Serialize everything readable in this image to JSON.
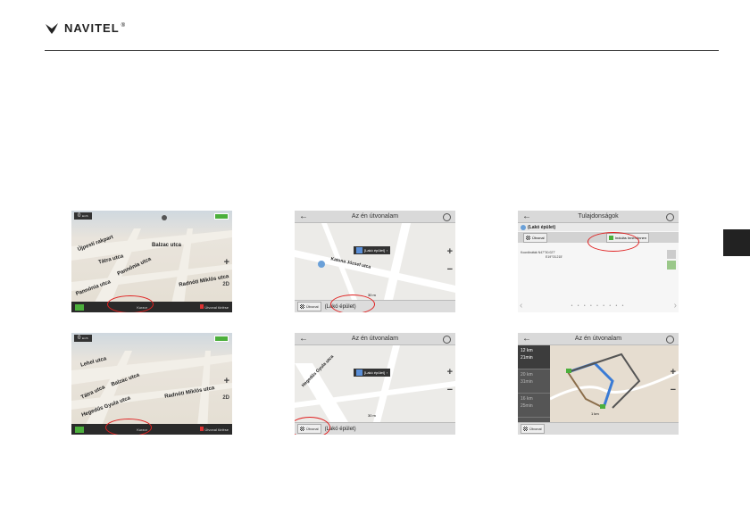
{
  "header": {
    "brand": "NAVITEL",
    "registered": "®"
  },
  "screens": {
    "map1": {
      "speed": "0",
      "speed_unit": "km/h",
      "streets": [
        "Újpesti rakpart",
        "Balzac utca",
        "Tátra utca",
        "Pannónia utca",
        "Radnóti Miklós utca",
        "Katona József utca",
        "Pannónia utca",
        "Pozsonyi út",
        "Hegedűs Gyula utca"
      ],
      "zoom_plus": "+",
      "zoom_minus": "−",
      "view_label": "2D",
      "bottom_center": "Kurzor",
      "bottom_right": "Útvonal törlése"
    },
    "route1": {
      "title": "Az én útvonalam",
      "popup_label": "[Lakó épület]",
      "street": "Katona József utca",
      "scale": "30 m",
      "route_button": "Útvonal",
      "bottom_label": "(Lakó épület)"
    },
    "props": {
      "title": "Tulajdonságok",
      "place": "(Lakó épület)",
      "toolbar_left": "Útvonal",
      "toolbar_right": "Indulás Innen/Innen",
      "coord_label": "Koordináták",
      "coord_lat": "N47°30.027'",
      "coord_lon": "E19°03.215'",
      "dots": "• • • • • • • • •"
    },
    "map2": {
      "speed": "0",
      "speed_unit": "km/h",
      "streets": [
        "Lehel utca",
        "Balzac utca",
        "Tátra utca",
        "Hegedűs Gyula utca",
        "Radnóti Miklós utca"
      ],
      "zoom_plus": "+",
      "zoom_minus": "−",
      "view_label": "2D",
      "bottom_center": "Kurzor",
      "bottom_right": "Útvonal törlése"
    },
    "route2": {
      "title": "Az én útvonalam",
      "popup_label": "[Lakó épület]",
      "street": "Hegedűs Gyula utca",
      "scale": "30 m",
      "route_button": "Útvonal",
      "bottom_label": "(Lakó épület)"
    },
    "route3": {
      "title": "Az én útvonalam",
      "routes": [
        {
          "dist": "12 km",
          "time": "21min"
        },
        {
          "dist": "20 km",
          "time": "31min"
        },
        {
          "dist": "16 km",
          "time": "25min"
        }
      ],
      "route_button": "Útvonal",
      "scale": "1 km"
    }
  },
  "colors": {
    "highlight": "#e02020",
    "accent_green": "#4caf3c",
    "route_blue": "#3a7bd5"
  }
}
